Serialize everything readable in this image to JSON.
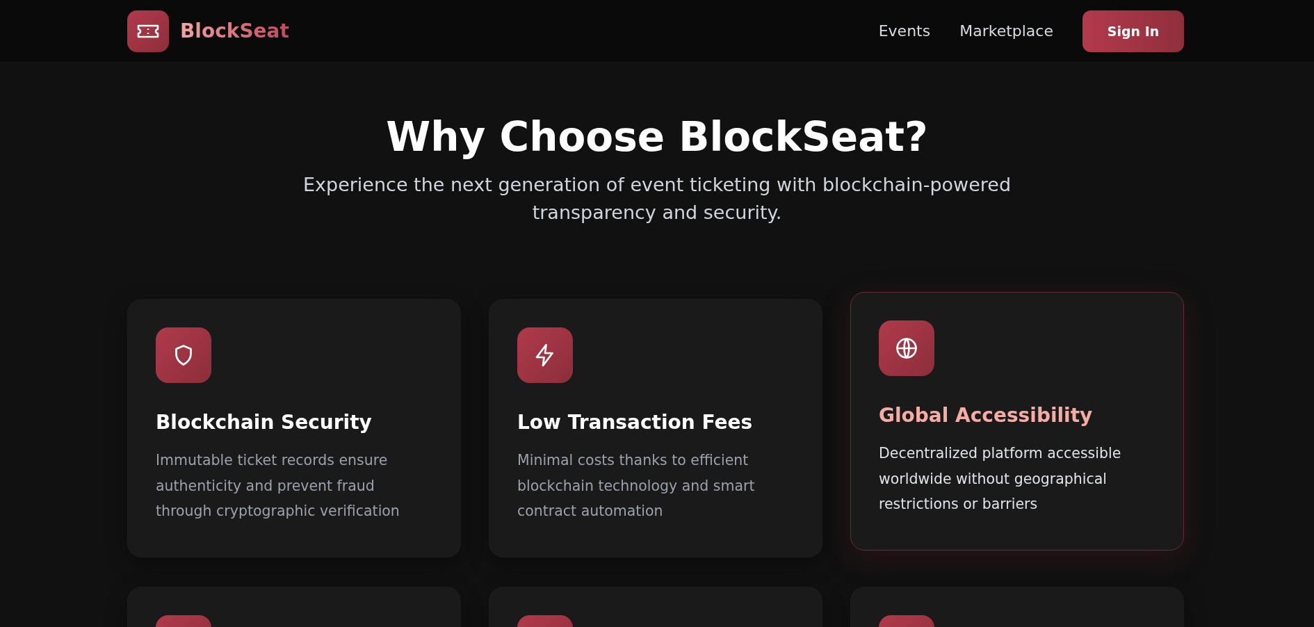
{
  "header": {
    "brand": "BlockSeat",
    "nav": [
      "Events",
      "Marketplace"
    ],
    "sign_in": "Sign In"
  },
  "hero": {
    "title": "Why Choose BlockSeat?",
    "subtitle": "Experience the next generation of event ticketing with blockchain-powered transparency and security."
  },
  "features": [
    {
      "kind": "shield",
      "title": "Blockchain Security",
      "description": "Immutable ticket records ensure authenticity and prevent fraud through cryptographic verification",
      "highlighted": false
    },
    {
      "kind": "bolt",
      "title": "Low Transaction Fees",
      "description": "Minimal costs thanks to efficient blockchain technology and smart contract automation",
      "highlighted": false
    },
    {
      "kind": "globe",
      "title": "Global Accessibility",
      "description": "Decentralized platform accessible worldwide without geographical restrictions or barriers",
      "highlighted": true
    }
  ],
  "next_row_cards": [
    {
      "kind": "card"
    },
    {
      "kind": "card"
    },
    {
      "kind": "card"
    }
  ]
}
